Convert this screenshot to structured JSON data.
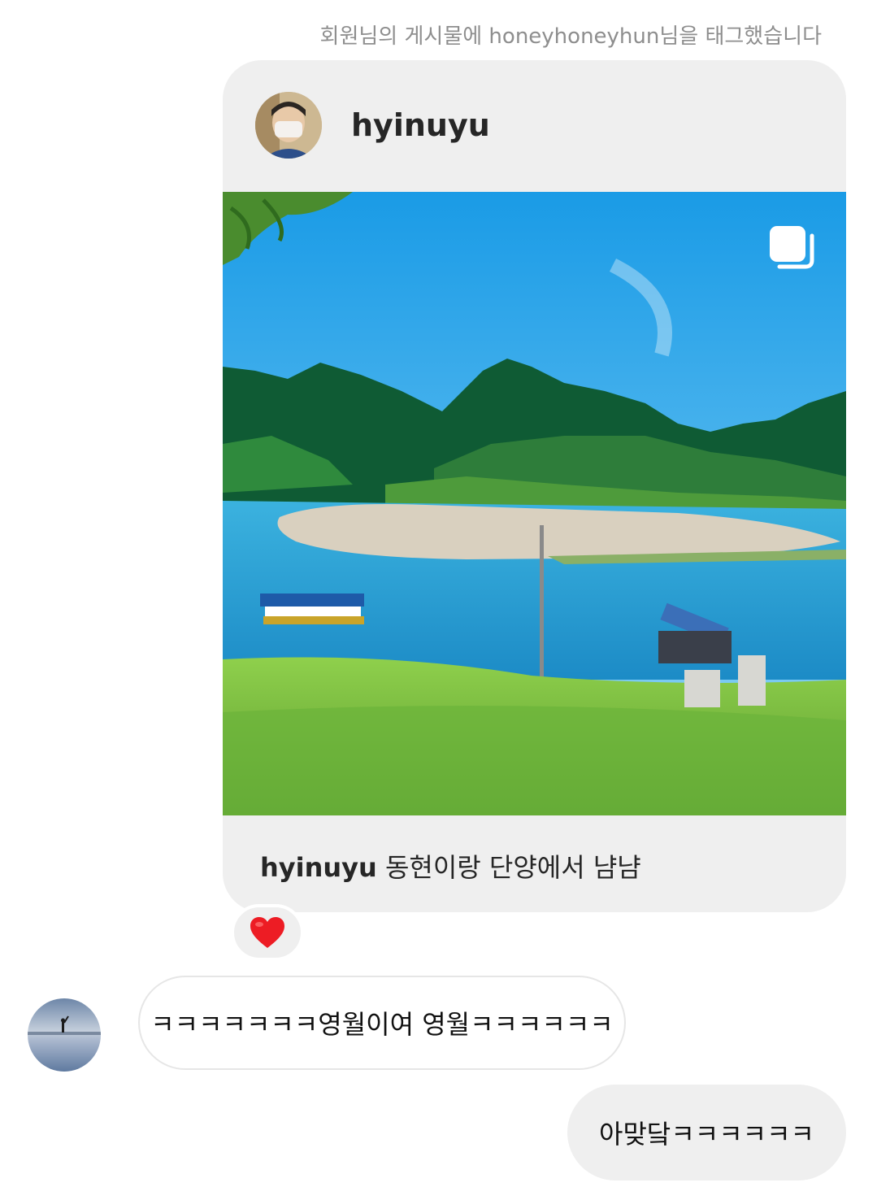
{
  "notice": "회원님의 게시물에 honeyhoneyhun님을 태그했습니다",
  "shared_post": {
    "author": "hyinuyu",
    "caption_user": "hyinuyu",
    "caption_text": "동현이랑 단양에서 냠냠",
    "carousel_icon": "multiple-photos-icon",
    "reaction": "❤️"
  },
  "messages": [
    {
      "from": "friend",
      "text": "ㅋㅋㅋㅋㅋㅋㅋ영월이여 영월ㅋㅋㅋㅋㅋㅋ"
    },
    {
      "from": "me",
      "text": "아맞닼ㅋㅋㅋㅋㅋㅋ"
    }
  ],
  "colors": {
    "bubble_gray": "#efefef",
    "notice_gray": "#8e8e8e",
    "heart": "#ed1c24"
  }
}
